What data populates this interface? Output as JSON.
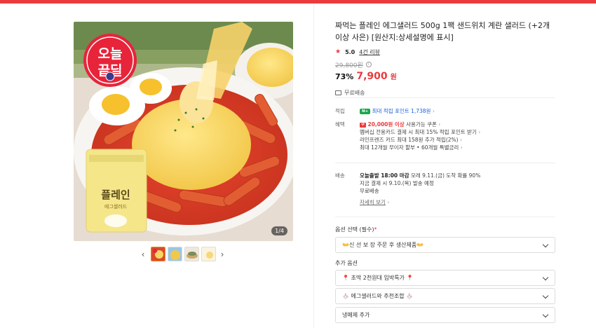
{
  "product": {
    "title": "짜먹는 플레인 에그샐러드 500g 1팩 샌드위치 계란 샐러드 (+2개이상 사은) [원산지:상세설명에 표시]",
    "rating": "5.0",
    "review_link": "4건 리뷰",
    "original_price": "29,800원",
    "discount": "73%",
    "price": "7,900",
    "price_unit": "원",
    "shipping": "무료배송"
  },
  "gallery": {
    "badge_line1": "오늘",
    "badge_line2": "끝딜",
    "package_brand_text": "플레인",
    "package_sub_text": "에그샐러드",
    "counter": "1/4",
    "prev_arrow": "‹",
    "next_arrow": "›",
    "thumbnail_count": 4
  },
  "benefits": {
    "points_label": "적립",
    "points_badge": "N+",
    "points_text": "최대 적립 포인트 1,738원",
    "benefit_label": "혜택",
    "coupon_badge": "쿠",
    "coupon_amount": "20,000원 이상",
    "coupon_rest": "사용가능 쿠폰",
    "lines": [
      "멤버십 전용카드 결제 시 최대 15% 적립 포인트 받기",
      "라인프렌즈 카드 최대 158원 추가 적립(2%)",
      "최대 12개월 무이자 할부 • 60개월 특별금리"
    ]
  },
  "delivery": {
    "label": "배송",
    "line1_strong": "오늘출발 18:00 마감",
    "line1_rest": "모레 9.11.(금) 도착 확률 90%",
    "line2": "지금 결제 시 9.10.(목) 발송 예정",
    "line3": "무료배송",
    "detail_link": "자세히 보기"
  },
  "options": {
    "required_label": "옵션 선택 (필수)",
    "required_mark": "*",
    "required_value": "👐신 선 보 장 주문 후 생산제품👐",
    "additional_label": "추가 옵션",
    "additional": [
      "📍 초딱 2천원대 입박특가 📍",
      "🧄 에그샐러드와 추천조합 🧄",
      "냉매제 추가"
    ]
  },
  "colors": {
    "accent": "#ea3a3e",
    "points": "#1e60d8",
    "naver_green": "#18a84a"
  }
}
